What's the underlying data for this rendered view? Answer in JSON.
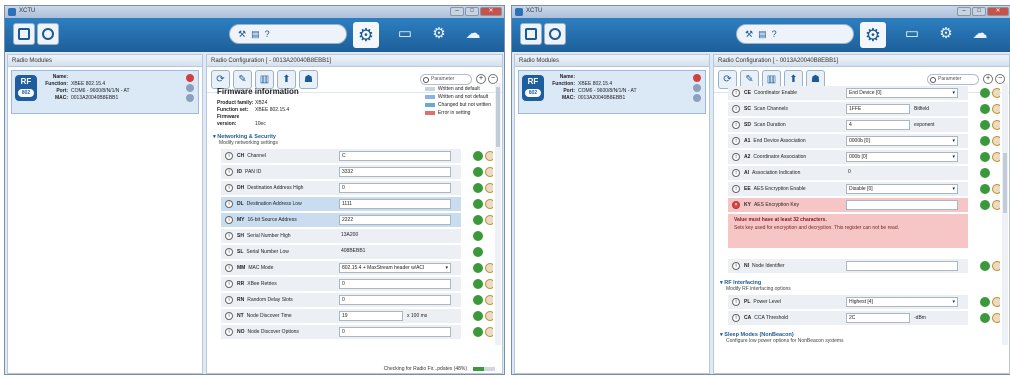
{
  "window_title": "XCTU",
  "toolbar": {
    "mid_icons": [
      "⚒",
      "▤",
      "?"
    ],
    "right_icons": [
      "▭",
      "⚙",
      "☁"
    ]
  },
  "modules": {
    "header": "Radio Modules",
    "item": {
      "name_label": "Name:",
      "name": "",
      "function_label": "Function:",
      "function": "XBEE 802.15.4",
      "port_label": "Port:",
      "port": "COM6 - 9600/8/N/1/N - AT",
      "mac_label": "MAC:",
      "mac": "0013A20040B8EBB1",
      "logo": "RF",
      "logo_sub": "802"
    }
  },
  "config": {
    "header": "Radio Configuration [ - 0013A20040B8EBB1]",
    "search_placeholder": "Parameter"
  },
  "left": {
    "fw_title": "Firmware information",
    "fw_rows": [
      {
        "label": "Product family:",
        "value": "XB24"
      },
      {
        "label": "Function set:",
        "value": "XBEE 802.15.4"
      },
      {
        "label": "Firmware version:",
        "value": "10ec"
      }
    ],
    "legend": [
      "Written and default",
      "Written and not default",
      "Changed but not written",
      "Error in setting"
    ],
    "legend_colors": [
      "#c9d3dd",
      "#8ab4e0",
      "#6aaad8",
      "#e07070"
    ],
    "section": "Networking & Security",
    "section_desc": "Modify networking settings",
    "params": [
      {
        "code": "CH",
        "name": "Channel",
        "value": "C"
      },
      {
        "code": "ID",
        "name": "PAN ID",
        "value": "3332"
      },
      {
        "code": "DH",
        "name": "Destination Address High",
        "value": "0"
      },
      {
        "code": "DL",
        "name": "Destination Address Low",
        "value": "1111"
      },
      {
        "code": "MY",
        "name": "16-bit Source Address",
        "value": "2222"
      },
      {
        "code": "SH",
        "name": "Serial Number High",
        "value": "13A200"
      },
      {
        "code": "SL",
        "name": "Serial Number Low",
        "value": "408BEBB1"
      },
      {
        "code": "MM",
        "name": "MAC Mode",
        "value": "802.15.4 + MaxStream header w/ACI"
      },
      {
        "code": "RR",
        "name": "XBee Retries",
        "value": "0"
      },
      {
        "code": "RN",
        "name": "Random Delay Slots",
        "value": "0"
      },
      {
        "code": "NT",
        "name": "Node Discover Time",
        "value": "19",
        "unit": "x 100 ms"
      },
      {
        "code": "NO",
        "name": "Node Discover Options",
        "value": "0"
      }
    ],
    "status": "Checking for Radio Fir...pdates (48%)",
    "status_progress": 0.48
  },
  "right": {
    "params_top": [
      {
        "code": "CE",
        "name": "Coordinator Enable",
        "value": "End Device [0]"
      },
      {
        "code": "SC",
        "name": "Scan Channels",
        "value": "1FFE",
        "unit": "Bitfield"
      },
      {
        "code": "SD",
        "name": "Scan Duration",
        "value": "4",
        "unit": "exponent"
      },
      {
        "code": "A1",
        "name": "End Device Association",
        "value": "0000b [0]"
      },
      {
        "code": "A2",
        "name": "Coordinator Association",
        "value": "000b [0]"
      },
      {
        "code": "AI",
        "name": "Association Indication",
        "value": "0"
      },
      {
        "code": "EE",
        "name": "AES Encryption Enable",
        "value": "Disable [0]"
      },
      {
        "code": "KY",
        "name": "AES Encryption Key",
        "value": ""
      }
    ],
    "error_title": "Value must have at least 32 characters.",
    "error_desc": "Sets key used for encryption and decryption. This register can not be read.",
    "ni": {
      "code": "NI",
      "name": "Node Identifier",
      "value": ""
    },
    "section2": "RF Interfacing",
    "section2_desc": "Modify RF interfacing options",
    "params_rf": [
      {
        "code": "PL",
        "name": "Power Level",
        "value": "Highest [4]"
      },
      {
        "code": "CA",
        "name": "CCA Threshold",
        "value": "2C",
        "unit": "-dBm"
      }
    ],
    "section3": "Sleep Modes (NonBeacon)",
    "section3_desc": "Configure low power options for NonBeacon systems"
  }
}
